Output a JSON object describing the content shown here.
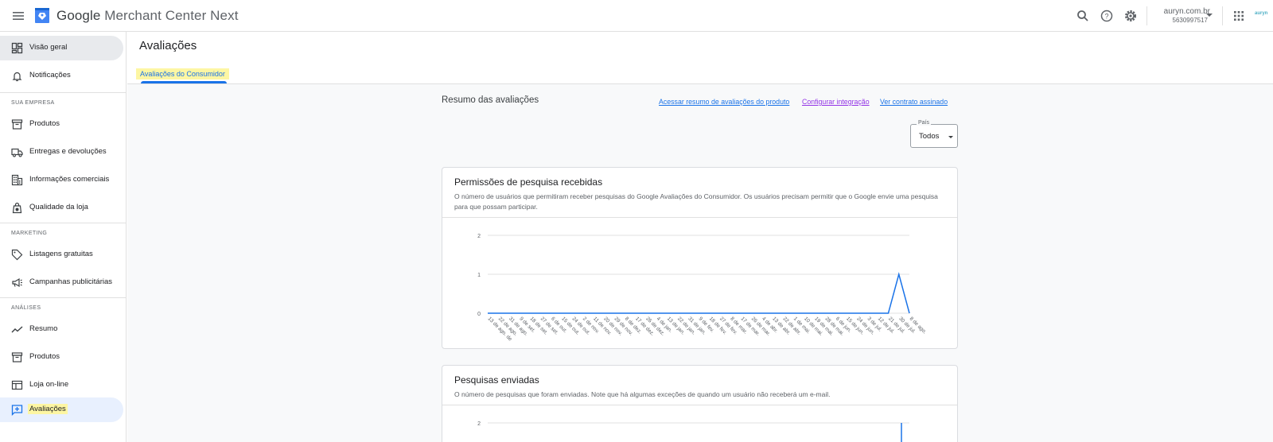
{
  "header": {
    "brand_google": "Google",
    "brand_product": " Merchant Center Next",
    "account_name": "auryn.com.br",
    "account_id": "5630997517",
    "app_logo": "auryn"
  },
  "sidebar": {
    "overview": "Visão geral",
    "notifications": "Notificações",
    "section_business": "SUA EMPRESA",
    "products": "Produtos",
    "shipping": "Entregas e devoluções",
    "business_info": "Informações comerciais",
    "store_quality": "Qualidade da loja",
    "section_marketing": "MARKETING",
    "free_listings": "Listagens gratuitas",
    "campaigns": "Campanhas publicitárias",
    "section_analytics": "ANÁLISES",
    "summary": "Resumo",
    "analytics_products": "Produtos",
    "online_store": "Loja on-line",
    "reviews": "Avaliações"
  },
  "main": {
    "title": "Avaliações",
    "tab": "Avaliações do Consumidor",
    "summary_title": "Resumo das avaliações",
    "links": {
      "product_summary": "Acessar resumo de avaliações do produto",
      "configure": "Configurar integração",
      "contract": "Ver contrato assinado"
    },
    "country_label": "País",
    "country_value": "Todos"
  },
  "cards": {
    "permissions": {
      "title": "Permissões de pesquisa recebidas",
      "description": "O número de usuários que permitiram receber pesquisas do Google Avaliações do Consumidor. Os usuários precisam permitir que o Google envie uma pesquisa para que possam participar."
    },
    "surveys": {
      "title": "Pesquisas enviadas",
      "description": "O número de pesquisas que foram enviadas. Note que há algumas exceções de quando um usuário não receberá um e-mail."
    }
  },
  "colors": {
    "accent": "#1a73e8",
    "highlight": "#fdf6a3",
    "visited_link": "#9334e6"
  },
  "chart_data": [
    {
      "type": "line",
      "title": "Permissões de pesquisa recebidas",
      "ylim": [
        0,
        2
      ],
      "y_ticks": [
        "0",
        "1",
        "2"
      ],
      "x": [
        "13 de ago. de",
        "22 de ago.",
        "31 de ago.",
        "9 de set.",
        "18 de set.",
        "27 de set.",
        "6 de out.",
        "15 de out.",
        "24 de out.",
        "2 de nov.",
        "11 de nov.",
        "20 de nov.",
        "29 de nov.",
        "8 de dez.",
        "17 de dez.",
        "26 de dez.",
        "4 de jan.",
        "13 de jan.",
        "22 de jan.",
        "31 de jan.",
        "9 de fev.",
        "18 de fev.",
        "27 de fev.",
        "8 de mar.",
        "17 de mar.",
        "26 de mar.",
        "4 de abr.",
        "13 de abr.",
        "22 de abr.",
        "1 de mai.",
        "10 de mai.",
        "19 de mai.",
        "28 de mai.",
        "6 de jun.",
        "15 de jun.",
        "24 de jun.",
        "3 de jul.",
        "12 de jul.",
        "21 de jul.",
        "30 de jul.",
        "8 de ago."
      ],
      "series": [
        {
          "values": [
            0,
            0,
            0,
            0,
            0,
            0,
            0,
            0,
            0,
            0,
            0,
            0,
            0,
            0,
            0,
            0,
            0,
            0,
            0,
            0,
            0,
            0,
            0,
            0,
            0,
            0,
            0,
            0,
            0,
            0,
            0,
            0,
            0,
            0,
            0,
            0,
            0,
            0,
            0,
            1,
            0
          ]
        }
      ],
      "grid": true
    },
    {
      "type": "line",
      "title": "Pesquisas enviadas",
      "y_ticks": [
        "2"
      ],
      "grid": true
    }
  ]
}
